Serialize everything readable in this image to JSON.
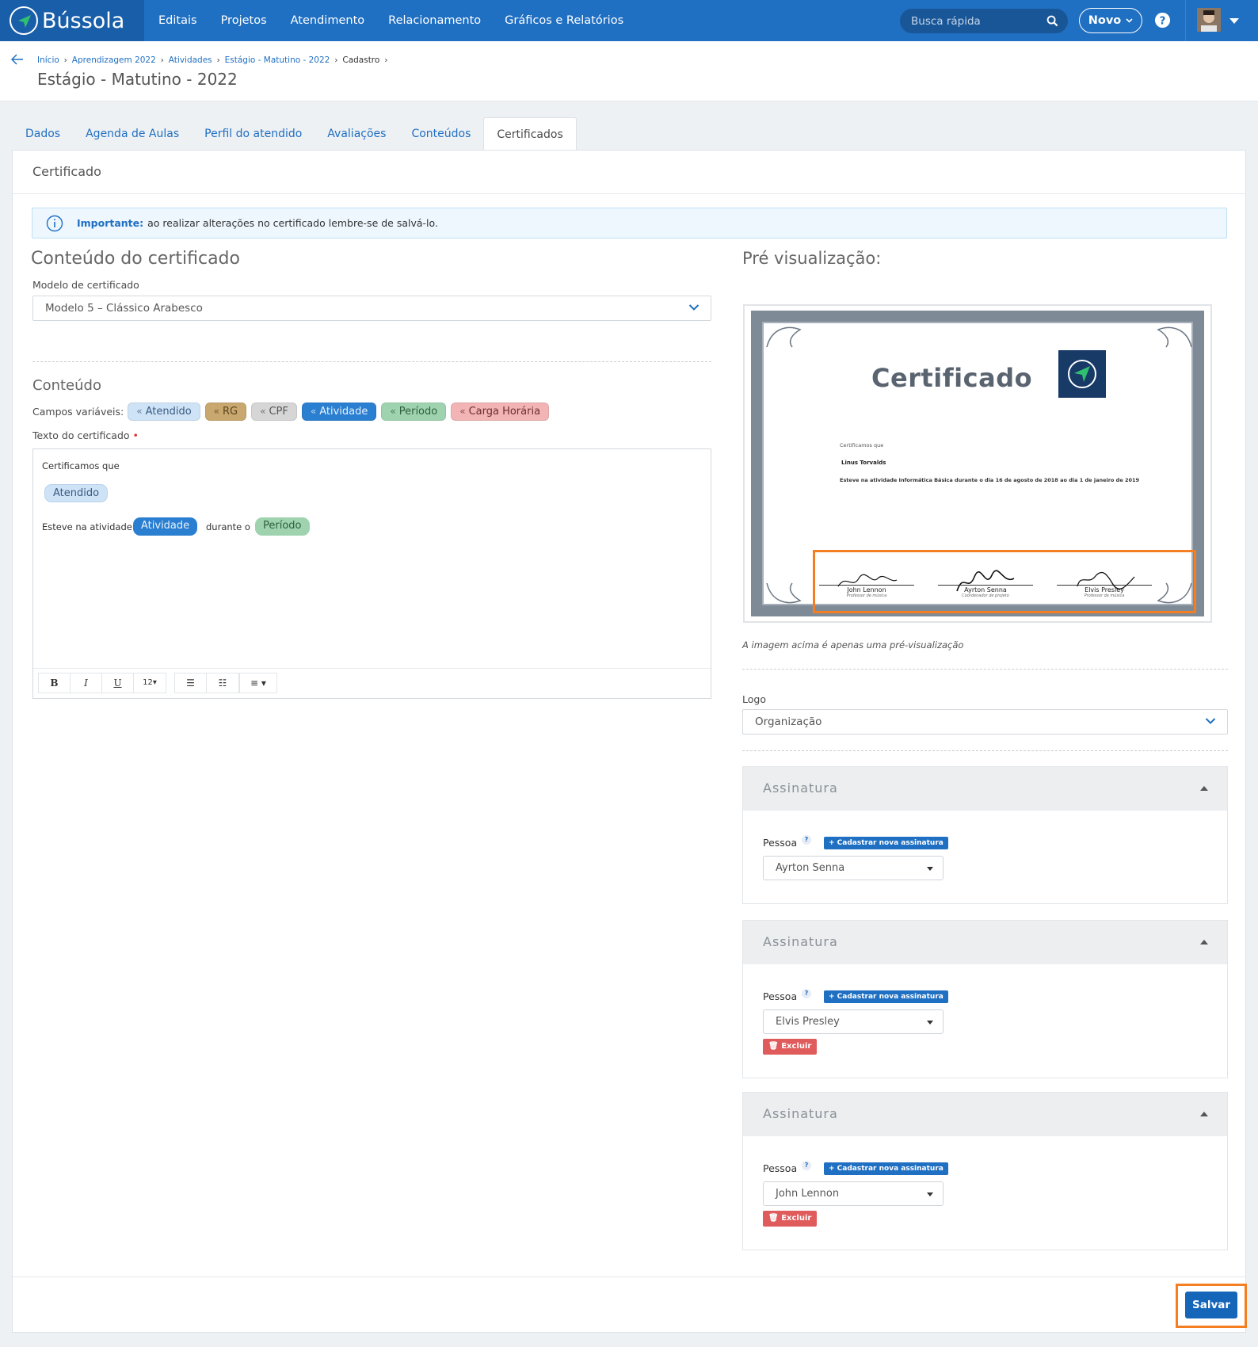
{
  "app": {
    "brand": "Bússola"
  },
  "nav": {
    "links": [
      "Editais",
      "Projetos",
      "Atendimento",
      "Relacionamento",
      "Gráficos e Relatórios"
    ],
    "search_placeholder": "Busca rápida",
    "novo_label": "Novo"
  },
  "breadcrumb": [
    "Início",
    "Aprendizagem 2022",
    "Atividades",
    "Estágio - Matutino - 2022",
    "Cadastro"
  ],
  "page_title": "Estágio - Matutino - 2022",
  "tabs": [
    "Dados",
    "Agenda de Aulas",
    "Perfil do atendido",
    "Avaliações",
    "Conteúdos",
    "Certificados"
  ],
  "panel_title": "Certificado",
  "alert": {
    "strong": "Importante:",
    "text": "ao realizar alterações no certificado lembre-se de salvá-lo."
  },
  "content": {
    "heading": "Conteúdo do certificado",
    "model_label": "Modelo de certificado",
    "model_value": "Modelo 5 – Clássico Arabesco",
    "sub_heading": "Conteúdo",
    "chips_label": "Campos variáveis:",
    "chips": [
      {
        "label": "Atendido",
        "bg": "#cfe3f7",
        "fg": "#3a5a80"
      },
      {
        "label": "RG",
        "bg": "#c8a86e",
        "fg": "#5a4320"
      },
      {
        "label": "CPF",
        "bg": "#d6d6d6",
        "fg": "#555555"
      },
      {
        "label": "Atividade",
        "bg": "#2b7fd1",
        "fg": "#e8f1fb"
      },
      {
        "label": "Período",
        "bg": "#9fd3b0",
        "fg": "#2d5e3c"
      },
      {
        "label": "Carga Horária",
        "bg": "#f2b4b4",
        "fg": "#6b2e2e"
      }
    ],
    "text_label": "Texto do certificado",
    "editor": {
      "line1": "Certificamos que",
      "chip_atendido": "Atendido",
      "line3_prefix": "Esteve na atividade",
      "chip_atividade": "Atividade",
      "line3_mid": "durante o",
      "chip_periodo": "Período"
    },
    "toolbar": {
      "bold": "B",
      "italic": "I",
      "underline": "U",
      "font_size": "12▾",
      "list_ul": "☰",
      "list_ol": "☷",
      "align": "≡ ▾"
    }
  },
  "preview": {
    "heading": "Pré visualização:",
    "cert_title": "Certificado",
    "cert_line1": "Certificamos que",
    "cert_name": "Linus Torvalds",
    "cert_line3": "Esteve na atividade  Informática Básica  durante o  dia 16 de agosto de 2018 ao dia 1 de janeiro de 2019",
    "signatures": [
      {
        "name": "John Lennon",
        "role": "Professor de música"
      },
      {
        "name": "Ayrton Senna",
        "role": "Coordenador de projeto"
      },
      {
        "name": "Elvis Presley",
        "role": "Professor de música"
      }
    ],
    "note": "A imagem acima é apenas uma pré-visualização"
  },
  "logo": {
    "label": "Logo",
    "value": "Organização"
  },
  "sig_cards": [
    {
      "title": "Assinatura",
      "person_label": "Pessoa",
      "new_btn": "+ Cadastrar nova assinatura",
      "person": "Ayrton Senna"
    },
    {
      "title": "Assinatura",
      "person_label": "Pessoa",
      "new_btn": "+ Cadastrar nova assinatura",
      "person": "Elvis Presley",
      "delete": "Excluir"
    },
    {
      "title": "Assinatura",
      "person_label": "Pessoa",
      "new_btn": "+ Cadastrar nova assinatura",
      "person": "John Lennon",
      "delete": "Excluir"
    }
  ],
  "save_label": "Salvar",
  "colors": {
    "nav": "#1f6fc2",
    "highlight": "#f57f20",
    "primary": "#1565b8"
  }
}
